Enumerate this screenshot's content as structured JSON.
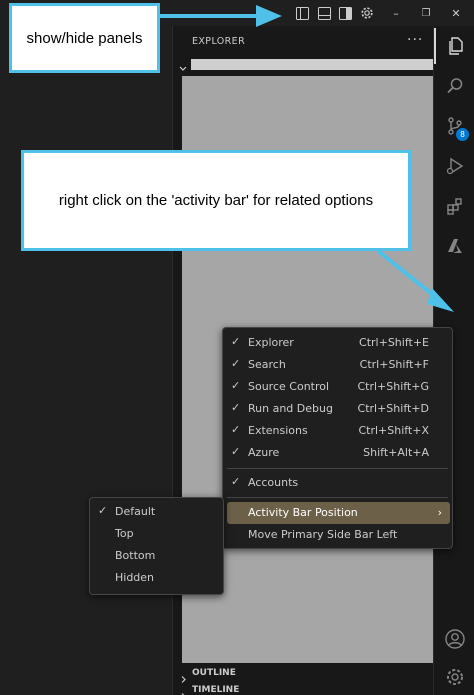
{
  "titlebar": {
    "icons": [
      "toggle-primary-sidebar-icon",
      "toggle-panel-icon",
      "toggle-secondary-sidebar-icon",
      "customize-layout-icon"
    ],
    "minimize_glyph": "–",
    "restore_glyph": "❐",
    "close_glyph": "✕"
  },
  "sidebar": {
    "title": "EXPLORER",
    "more_glyph": "···",
    "sections": [
      {
        "label": "OUTLINE"
      },
      {
        "label": "TIMELINE"
      }
    ]
  },
  "activitybar": {
    "items": [
      "explorer-icon",
      "search-icon",
      "source-control-icon",
      "run-debug-icon",
      "extensions-icon",
      "azure-icon"
    ],
    "badge": "8",
    "bottom": [
      "accounts-icon",
      "manage-icon"
    ]
  },
  "callouts": {
    "panels": "show/hide panels",
    "activity": "right click on the 'activity bar' for related options"
  },
  "context_menu": {
    "items": [
      {
        "check": "✓",
        "label": "Explorer",
        "shortcut": "Ctrl+Shift+E"
      },
      {
        "check": "✓",
        "label": "Search",
        "shortcut": "Ctrl+Shift+F"
      },
      {
        "check": "✓",
        "label": "Source Control",
        "shortcut": "Ctrl+Shift+G"
      },
      {
        "check": "✓",
        "label": "Run and Debug",
        "shortcut": "Ctrl+Shift+D"
      },
      {
        "check": "✓",
        "label": "Extensions",
        "shortcut": "Ctrl+Shift+X"
      },
      {
        "check": "✓",
        "label": "Azure",
        "shortcut": "Shift+Alt+A"
      },
      {
        "check": "✓",
        "label": "Accounts",
        "shortcut": ""
      },
      {
        "check": "",
        "label": "Activity Bar Position",
        "shortcut": "",
        "submenu": "›"
      },
      {
        "check": "",
        "label": "Move Primary Side Bar Left",
        "shortcut": ""
      }
    ]
  },
  "submenu": {
    "items": [
      {
        "check": "✓",
        "label": "Default"
      },
      {
        "check": "",
        "label": "Top"
      },
      {
        "check": "",
        "label": "Bottom"
      },
      {
        "check": "",
        "label": "Hidden"
      }
    ]
  },
  "colors": {
    "callout_border": "#4fc1e9",
    "highlight": "#6d6048",
    "badge": "#0078d4"
  }
}
